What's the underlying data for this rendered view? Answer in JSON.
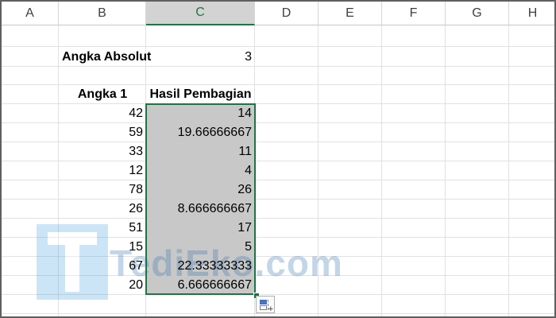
{
  "columns": [
    "A",
    "B",
    "C",
    "D",
    "E",
    "F",
    "G",
    "H"
  ],
  "selected_column": "C",
  "absolute": {
    "label": "Angka Absolut",
    "value": "3"
  },
  "table": {
    "header_1": "Angka 1",
    "header_2": "Hasil Pembagian",
    "rows": [
      {
        "a": "42",
        "b": "14"
      },
      {
        "a": "59",
        "b": "19.66666667"
      },
      {
        "a": "33",
        "b": "11"
      },
      {
        "a": "12",
        "b": "4"
      },
      {
        "a": "78",
        "b": "26"
      },
      {
        "a": "26",
        "b": "8.666666667"
      },
      {
        "a": "51",
        "b": "17"
      },
      {
        "a": "15",
        "b": "5"
      },
      {
        "a": "67",
        "b": "22.33333333"
      },
      {
        "a": "20",
        "b": "6.666666667"
      }
    ]
  },
  "watermark": {
    "text": "TediEko.com"
  },
  "colors": {
    "selection_fill": "#c8c8c8",
    "selection_border": "#217346",
    "header_selected": "#d3d3d3"
  }
}
